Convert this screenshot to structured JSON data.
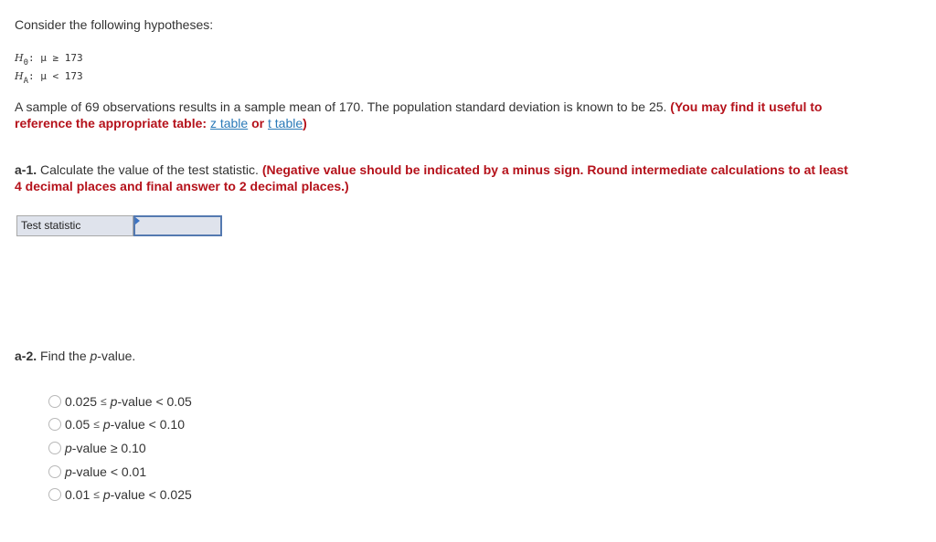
{
  "intro": "Consider the following hypotheses:",
  "hypotheses": {
    "h0_label": "H",
    "h0_sub": "0",
    "h0_expr": ": μ ≥ 173",
    "ha_label": "H",
    "ha_sub": "A",
    "ha_expr": ": μ < 173"
  },
  "problem": {
    "text": "A sample of 69 observations results in a sample mean of 170. The population standard deviation is known to be 25. ",
    "note_start": "(You may find it useful to reference the appropriate table: ",
    "link_z": "z table",
    "or": " or ",
    "link_t": "t table",
    "note_end": ")"
  },
  "a1": {
    "label": "a-1.",
    "text": " Calculate the value of the test statistic. ",
    "note": "(Negative value should be indicated by a minus sign. Round intermediate calculations to at least 4 decimal places and final answer to 2 decimal places.)"
  },
  "test_statistic": {
    "label": "Test statistic",
    "value": ""
  },
  "a2": {
    "label": "a-2.",
    "text_before": " Find the ",
    "p": "p",
    "text_after": "-value."
  },
  "options": [
    {
      "pre": "0.025",
      "op1": "≤",
      "p": "p",
      "mid": "-value < 0.05"
    },
    {
      "pre": "0.05",
      "op1": "≤",
      "p": "p",
      "mid": "-value < 0.10"
    },
    {
      "pre": "",
      "op1": "",
      "p": "p",
      "mid": "-value ≥ 0.10"
    },
    {
      "pre": "",
      "op1": "",
      "p": "p",
      "mid": "-value < 0.01"
    },
    {
      "pre": "0.01",
      "op1": "≤",
      "p": "p",
      "mid": "-value < 0.025"
    }
  ]
}
